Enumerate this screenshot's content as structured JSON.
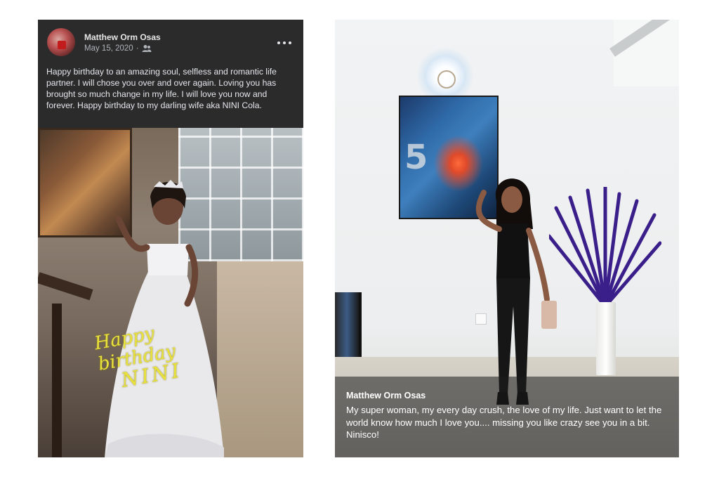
{
  "left_post": {
    "author": "Matthew Orm Osas",
    "date": "May 15, 2020",
    "audience_icon": "friends-icon",
    "more_icon": "more-options-icon",
    "text": "Happy birthday to an amazing soul, selfless and romantic life partner. I will chose you over and over again. Loving you has brought so much change in my life. I will love you now and forever. Happy birthday to my darling wife aka NINI Cola.",
    "overlay_line1": "Happy birthday",
    "overlay_line2": "NINI"
  },
  "right_post": {
    "author": "Matthew Orm Osas",
    "text": "My super woman, my every day crush, the love of my life. Just want to let the world know how much I love you.... missing you like crazy see you in a bit.",
    "signoff": "Ninisco!"
  },
  "colors": {
    "post_bg": "#2b2b2c",
    "overlay_text": "#e9e23c",
    "caption_bg": "rgba(30,30,30,0.55)"
  }
}
